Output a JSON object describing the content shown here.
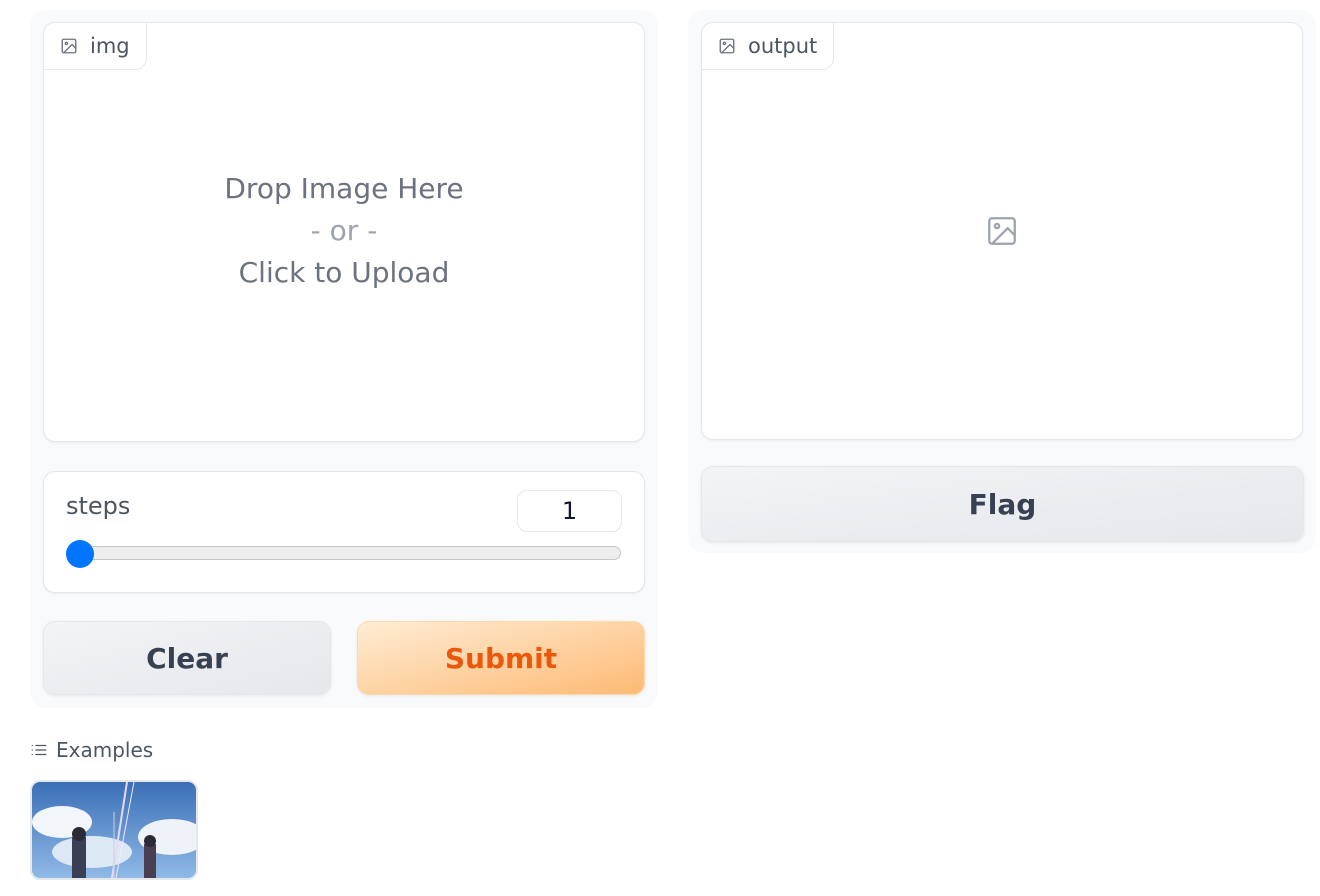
{
  "input": {
    "label": "img",
    "drop_line1": "Drop Image Here",
    "drop_or": "- or -",
    "drop_line2": "Click to Upload"
  },
  "output": {
    "label": "output"
  },
  "steps": {
    "label": "steps",
    "value": "1",
    "slider_fraction": 0.0
  },
  "buttons": {
    "clear": "Clear",
    "submit": "Submit",
    "flag": "Flag"
  },
  "examples": {
    "title": "Examples",
    "items": [
      {
        "icon": "anime-image-thumbnail"
      }
    ]
  },
  "colors": {
    "accent_submit": "#ea580c",
    "slider_thumb": "#0075ff"
  }
}
